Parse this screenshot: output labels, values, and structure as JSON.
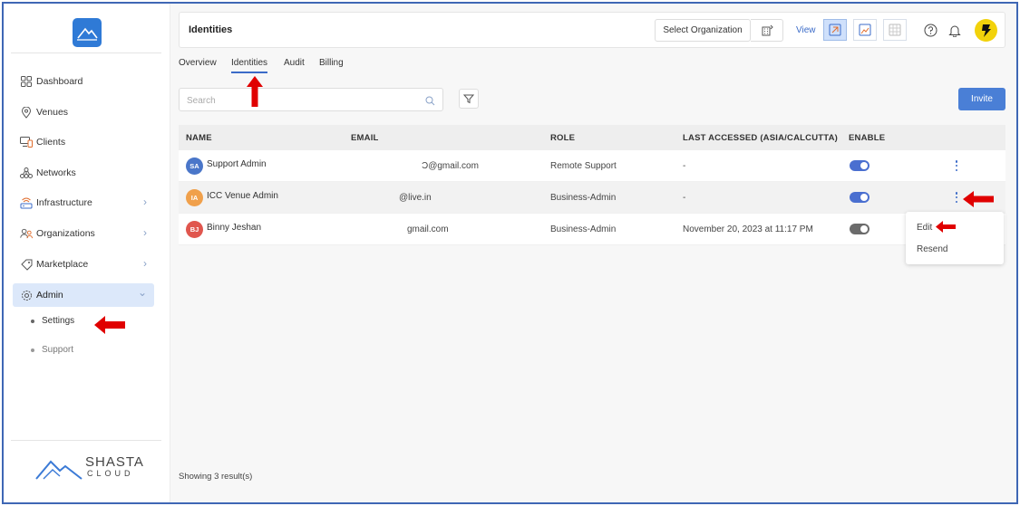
{
  "sidebar": {
    "items": [
      {
        "label": "Dashboard",
        "icon": "dashboard-icon"
      },
      {
        "label": "Venues",
        "icon": "location-pin-icon"
      },
      {
        "label": "Clients",
        "icon": "clients-icon"
      },
      {
        "label": "Networks",
        "icon": "networks-icon"
      },
      {
        "label": "Infrastructure",
        "icon": "router-icon"
      },
      {
        "label": "Organizations",
        "icon": "organizations-icon"
      },
      {
        "label": "Marketplace",
        "icon": "tag-icon"
      },
      {
        "label": "Admin",
        "icon": "gear-icon"
      }
    ],
    "sub_items": [
      {
        "label": "Settings"
      },
      {
        "label": "Support"
      }
    ],
    "brand": {
      "name": "SHASTA",
      "sub": "CLOUD"
    }
  },
  "header": {
    "title": "Identities",
    "org_select": "Select Organization",
    "view_label": "View"
  },
  "tabs": [
    {
      "label": "Overview"
    },
    {
      "label": "Identities"
    },
    {
      "label": "Audit"
    },
    {
      "label": "Billing"
    }
  ],
  "search": {
    "placeholder": "Search"
  },
  "invite_label": "Invite",
  "table": {
    "headers": [
      "NAME",
      "EMAIL",
      "ROLE",
      "LAST ACCESSED (ASIA/CALCUTTA)",
      "ENABLE"
    ],
    "rows": [
      {
        "initials": "SA",
        "name": "Support Admin",
        "email": "Ͻ@gmail.com",
        "role": "Remote Support",
        "last_accessed": "-",
        "enabled": true,
        "avatar_color": "#4a76c9"
      },
      {
        "initials": "IA",
        "name": "ICC Venue Admin",
        "email": "@live.in",
        "role": "Business-Admin",
        "last_accessed": "-",
        "enabled": true,
        "avatar_color": "#f0a04b"
      },
      {
        "initials": "BJ",
        "name": "Binny Jeshan",
        "email": "gmail.com",
        "role": "Business-Admin",
        "last_accessed": "November 20, 2023 at 11:17 PM",
        "enabled": false,
        "avatar_color": "#e0564e"
      }
    ]
  },
  "menu": {
    "edit": "Edit",
    "resend": "Resend"
  },
  "footer": {
    "count": "Showing 3 result(s)"
  },
  "colors": {
    "accent": "#4a7fd6",
    "toggle_on": "#4a6fd0",
    "toggle_off": "#6b6b6b",
    "annotation": "#e00000"
  }
}
